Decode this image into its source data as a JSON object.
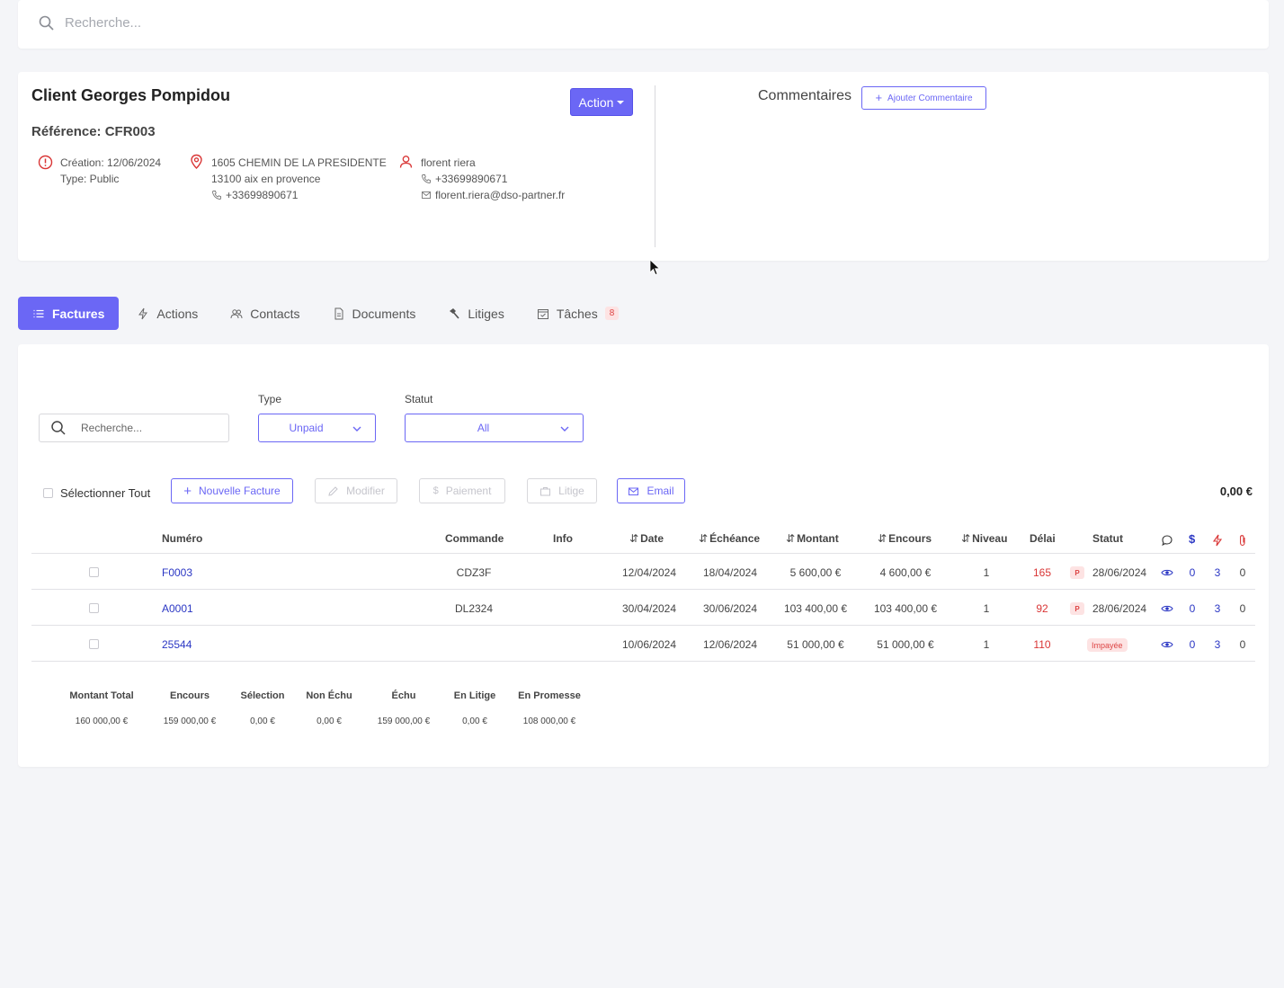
{
  "search": {
    "placeholder": "Recherche..."
  },
  "client": {
    "name": "Client Georges Pompidou",
    "reference": "Référence: CFR003",
    "action_label": "Action",
    "creation": "Création: 12/06/2024",
    "type": "Type: Public",
    "address_line1": "1605 CHEMIN DE LA PRESIDENTE",
    "address_line2": "13100 aix en provence",
    "address_phone": "+33699890671",
    "contact_name": "florent riera",
    "contact_phone": "+33699890671",
    "contact_email": "florent.riera@dso-partner.fr"
  },
  "comments": {
    "title": "Commentaires",
    "add_label": "Ajouter Commentaire"
  },
  "tabs": [
    {
      "label": "Factures",
      "icon": "list-icon",
      "active": true
    },
    {
      "label": "Actions",
      "icon": "lightning-icon"
    },
    {
      "label": "Contacts",
      "icon": "users-icon"
    },
    {
      "label": "Documents",
      "icon": "document-icon"
    },
    {
      "label": "Litiges",
      "icon": "hammer-icon"
    },
    {
      "label": "Tâches",
      "icon": "calendar-icon",
      "badge": "8"
    }
  ],
  "filters": {
    "search_placeholder": "Recherche...",
    "type_label": "Type",
    "type_value": "Unpaid",
    "statut_label": "Statut",
    "statut_value": "All"
  },
  "toolbar": {
    "select_all": "Sélectionner Tout",
    "new_invoice": "Nouvelle Facture",
    "modify": "Modifier",
    "payment": "Paiement",
    "dispute": "Litige",
    "email": "Email",
    "selected_total": "0,00 €"
  },
  "table": {
    "headers": {
      "numero": "Numéro",
      "commande": "Commande",
      "info": "Info",
      "date": "Date",
      "echeance": "Échéance",
      "montant": "Montant",
      "encours": "Encours",
      "niveau": "Niveau",
      "delai": "Délai",
      "statut": "Statut"
    },
    "rows": [
      {
        "numero": "F0003",
        "commande": "CDZ3F",
        "date": "12/04/2024",
        "echeance": "18/04/2024",
        "montant": "5 600,00 €",
        "encours": "4 600,00 €",
        "niveau": "1",
        "delai": "165",
        "statut_badge": "P",
        "statut_date": "28/06/2024",
        "comments": "0",
        "payments": "3",
        "attachments": "0"
      },
      {
        "numero": "A0001",
        "commande": "DL2324",
        "date": "30/04/2024",
        "echeance": "30/06/2024",
        "montant": "103 400,00 €",
        "encours": "103 400,00 €",
        "niveau": "1",
        "delai": "92",
        "statut_badge": "P",
        "statut_date": "28/06/2024",
        "comments": "0",
        "payments": "3",
        "attachments": "0"
      },
      {
        "numero": "25544",
        "commande": "",
        "date": "10/06/2024",
        "echeance": "12/06/2024",
        "montant": "51 000,00 €",
        "encours": "51 000,00 €",
        "niveau": "1",
        "delai": "110",
        "statut_label": "Impayée",
        "comments": "0",
        "payments": "3",
        "attachments": "0"
      }
    ]
  },
  "summary": {
    "headers": [
      "Montant Total",
      "Encours",
      "Sélection",
      "Non Échu",
      "Échu",
      "En Litige",
      "En Promesse"
    ],
    "values": [
      "160 000,00 €",
      "159 000,00 €",
      "0,00 €",
      "0,00 €",
      "159 000,00 €",
      "0,00 €",
      "108 000,00 €"
    ]
  },
  "colors": {
    "accent": "#6b67f5",
    "link": "#2b37c4",
    "danger": "#d93636"
  }
}
